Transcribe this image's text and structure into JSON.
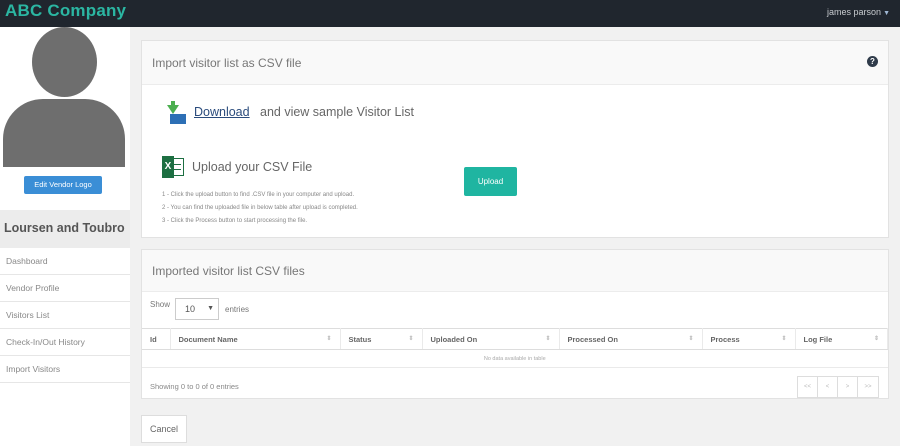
{
  "app": {
    "brand": "ABC Company",
    "user_name": "james parson"
  },
  "sidebar": {
    "edit_logo_label": "Edit Vendor Logo",
    "company_name": "Loursen and Toubro",
    "items": [
      {
        "label": "Dashboard"
      },
      {
        "label": "Vendor Profile"
      },
      {
        "label": "Visitors List"
      },
      {
        "label": "Check-In/Out History"
      },
      {
        "label": "Import Visitors"
      }
    ]
  },
  "import_panel": {
    "title": "Import visitor list as CSV file",
    "download_link": "Download",
    "download_rest": "and view sample Visitor List",
    "upload_title": "Upload your CSV File",
    "instructions": [
      "1 - Click the upload button to find .CSV file in your computer and upload.",
      "2 - You can find the uploaded file in below table after upload is completed.",
      "3 - Click the Process button to start processing the file."
    ],
    "upload_button": "Upload"
  },
  "files_panel": {
    "title": "Imported visitor list CSV files",
    "show_label": "Show",
    "entries_value": "10",
    "entries_label": "entries",
    "columns": [
      "Id",
      "Document Name",
      "Status",
      "Uploaded On",
      "Processed On",
      "Process",
      "Log File"
    ],
    "empty_message": "No data available in table",
    "showing": "Showing 0 to 0 of 0 entries",
    "pager": [
      "<<",
      "<",
      ">",
      ">>"
    ]
  },
  "footer": {
    "cancel_label": "Cancel"
  }
}
